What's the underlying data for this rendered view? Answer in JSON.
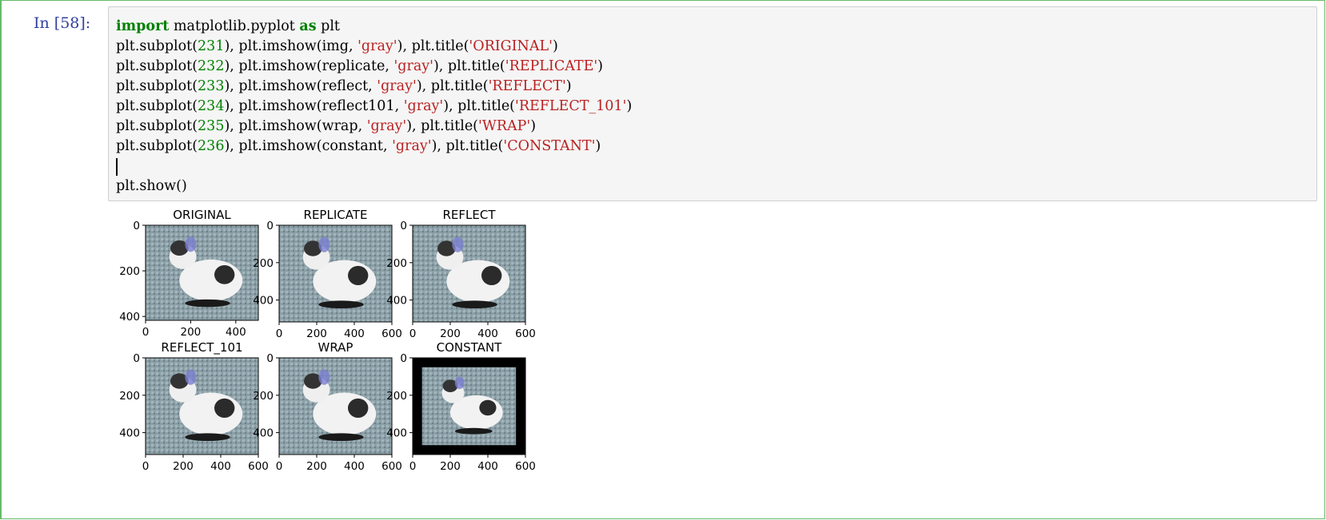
{
  "cell": {
    "prompt": "In [58]:",
    "code_lines": [
      [
        {
          "t": "import",
          "c": "kw"
        },
        {
          "t": " matplotlib.pyplot "
        },
        {
          "t": "as",
          "c": "kw"
        },
        {
          "t": " plt"
        }
      ],
      [
        {
          "t": "plt.subplot("
        },
        {
          "t": "231",
          "c": "num"
        },
        {
          "t": "), plt.imshow(img, "
        },
        {
          "t": "'gray'",
          "c": "str"
        },
        {
          "t": "), plt.title("
        },
        {
          "t": "'ORIGINAL'",
          "c": "str"
        },
        {
          "t": ")"
        }
      ],
      [
        {
          "t": "plt.subplot("
        },
        {
          "t": "232",
          "c": "num"
        },
        {
          "t": "), plt.imshow(replicate, "
        },
        {
          "t": "'gray'",
          "c": "str"
        },
        {
          "t": "), plt.title("
        },
        {
          "t": "'REPLICATE'",
          "c": "str"
        },
        {
          "t": ")"
        }
      ],
      [
        {
          "t": "plt.subplot("
        },
        {
          "t": "233",
          "c": "num"
        },
        {
          "t": "), plt.imshow(reflect, "
        },
        {
          "t": "'gray'",
          "c": "str"
        },
        {
          "t": "), plt.title("
        },
        {
          "t": "'REFLECT'",
          "c": "str"
        },
        {
          "t": ")"
        }
      ],
      [
        {
          "t": "plt.subplot("
        },
        {
          "t": "234",
          "c": "num"
        },
        {
          "t": "), plt.imshow(reflect101, "
        },
        {
          "t": "'gray'",
          "c": "str"
        },
        {
          "t": "), plt.title("
        },
        {
          "t": "'REFLECT_101'",
          "c": "str"
        },
        {
          "t": ")"
        }
      ],
      [
        {
          "t": "plt.subplot("
        },
        {
          "t": "235",
          "c": "num"
        },
        {
          "t": "), plt.imshow(wrap, "
        },
        {
          "t": "'gray'",
          "c": "str"
        },
        {
          "t": "), plt.title("
        },
        {
          "t": "'WRAP'",
          "c": "str"
        },
        {
          "t": ")"
        }
      ],
      [
        {
          "t": "plt.subplot("
        },
        {
          "t": "236",
          "c": "num"
        },
        {
          "t": "), plt.imshow(constant, "
        },
        {
          "t": "'gray'",
          "c": "str"
        },
        {
          "t": "), plt.title("
        },
        {
          "t": "'CONSTANT'",
          "c": "str"
        },
        {
          "t": ")"
        }
      ],
      [
        {
          "t": "",
          "c": "cursor"
        }
      ],
      [
        {
          "t": "plt.show()"
        }
      ]
    ]
  },
  "colors": {
    "keyword": "#008000",
    "string": "#ba2121",
    "prompt": "#303f9f",
    "cell_border": "#66bb6a"
  },
  "chart_data": [
    {
      "type": "image",
      "title": "ORIGINAL",
      "xticks": [
        "0",
        "200",
        "400"
      ],
      "yticks": [
        "0",
        "200",
        "400"
      ],
      "xlim": [
        0,
        500
      ],
      "ylim": [
        417,
        0
      ],
      "border": "none"
    },
    {
      "type": "image",
      "title": "REPLICATE",
      "xticks": [
        "0",
        "200",
        "400",
        "600"
      ],
      "yticks": [
        "0",
        "200",
        "400"
      ],
      "xlim": [
        0,
        600
      ],
      "ylim": [
        517,
        0
      ],
      "border": "replicate"
    },
    {
      "type": "image",
      "title": "REFLECT",
      "xticks": [
        "0",
        "200",
        "400",
        "600"
      ],
      "yticks": [
        "0",
        "200",
        "400"
      ],
      "xlim": [
        0,
        600
      ],
      "ylim": [
        517,
        0
      ],
      "border": "reflect"
    },
    {
      "type": "image",
      "title": "REFLECT_101",
      "xticks": [
        "0",
        "200",
        "400",
        "600"
      ],
      "yticks": [
        "0",
        "200",
        "400"
      ],
      "xlim": [
        0,
        600
      ],
      "ylim": [
        517,
        0
      ],
      "border": "reflect101"
    },
    {
      "type": "image",
      "title": "WRAP",
      "xticks": [
        "0",
        "200",
        "400",
        "600"
      ],
      "yticks": [
        "0",
        "200",
        "400"
      ],
      "xlim": [
        0,
        600
      ],
      "ylim": [
        517,
        0
      ],
      "border": "wrap"
    },
    {
      "type": "image",
      "title": "CONSTANT",
      "xticks": [
        "0",
        "200",
        "400",
        "600"
      ],
      "yticks": [
        "0",
        "200",
        "400"
      ],
      "xlim": [
        0,
        600
      ],
      "ylim": [
        517,
        0
      ],
      "border": "constant"
    }
  ]
}
